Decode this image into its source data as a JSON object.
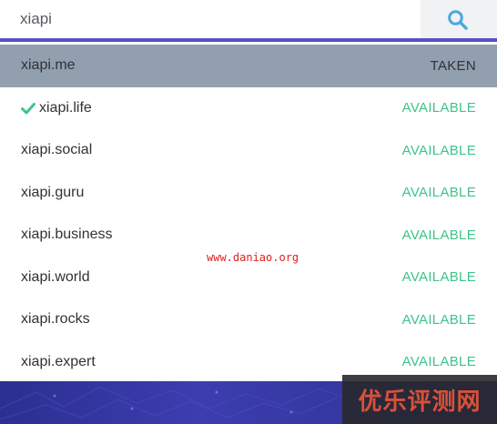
{
  "search": {
    "value": "xiapi",
    "button_icon": "search-icon"
  },
  "colors": {
    "accent_border": "#5a4fc8",
    "search_icon": "#4aa8e0",
    "taken_row_bg": "#929faf",
    "available": "#3ec48a",
    "banner": "#34379f",
    "watermark_text": "#d9503a",
    "watermark_url": "#e02020"
  },
  "results": [
    {
      "domain": "xiapi.me",
      "status": "TAKEN",
      "checked": false
    },
    {
      "domain": "xiapi.life",
      "status": "AVAILABLE",
      "checked": true
    },
    {
      "domain": "xiapi.social",
      "status": "AVAILABLE",
      "checked": false
    },
    {
      "domain": "xiapi.guru",
      "status": "AVAILABLE",
      "checked": false
    },
    {
      "domain": "xiapi.business",
      "status": "AVAILABLE",
      "checked": false
    },
    {
      "domain": "xiapi.world",
      "status": "AVAILABLE",
      "checked": false
    },
    {
      "domain": "xiapi.rocks",
      "status": "AVAILABLE",
      "checked": false
    },
    {
      "domain": "xiapi.expert",
      "status": "AVAILABLE",
      "checked": false
    }
  ],
  "watermarks": {
    "url": "www.daniao.org",
    "brand": "优乐评测网"
  }
}
